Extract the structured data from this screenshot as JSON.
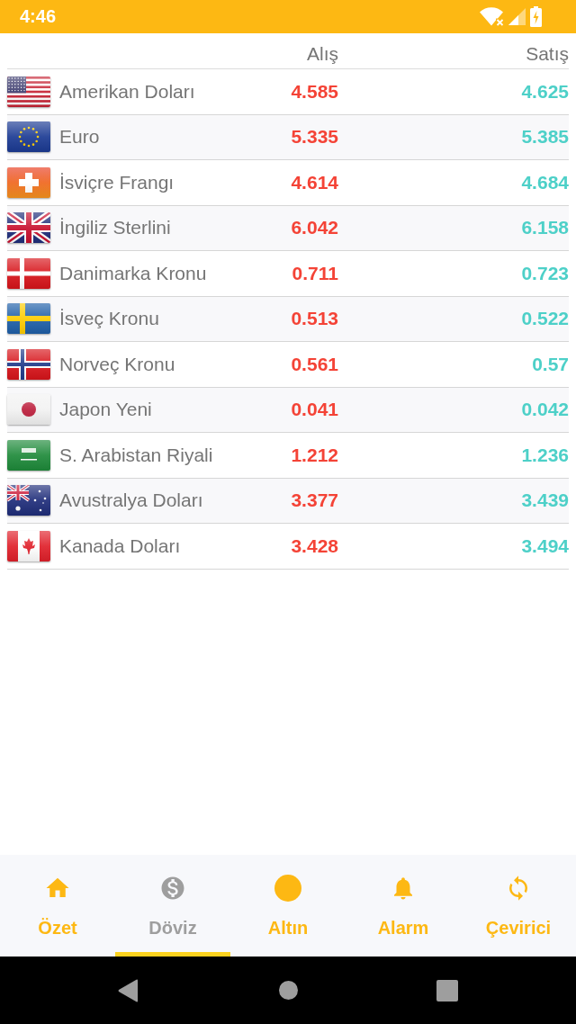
{
  "status_bar": {
    "time": "4:46"
  },
  "table": {
    "columns": [
      "Alış",
      "Satış"
    ],
    "rows": [
      {
        "kind": "us",
        "name": "Amerikan Doları",
        "buy": "4.585",
        "sell": "4.625"
      },
      {
        "kind": "eu",
        "name": "Euro",
        "buy": "5.335",
        "sell": "5.385"
      },
      {
        "kind": "ch",
        "name": "İsviçre Frangı",
        "buy": "4.614",
        "sell": "4.684"
      },
      {
        "kind": "gb",
        "name": "İngiliz Sterlini",
        "buy": "6.042",
        "sell": "6.158"
      },
      {
        "kind": "dk",
        "name": "Danimarka Kronu",
        "buy": "0.711",
        "sell": "0.723"
      },
      {
        "kind": "se",
        "name": "İsveç Kronu",
        "buy": "0.513",
        "sell": "0.522"
      },
      {
        "kind": "no",
        "name": "Norveç Kronu",
        "buy": "0.561",
        "sell": "0.57"
      },
      {
        "kind": "jp",
        "name": "Japon Yeni",
        "buy": "0.041",
        "sell": "0.042"
      },
      {
        "kind": "sa",
        "name": "S. Arabistan Riyali",
        "buy": "1.212",
        "sell": "1.236"
      },
      {
        "kind": "au",
        "name": "Avustralya Doları",
        "buy": "3.377",
        "sell": "3.439"
      },
      {
        "kind": "ca",
        "name": "Kanada Doları",
        "buy": "3.428",
        "sell": "3.494"
      }
    ]
  },
  "tabs": [
    {
      "kind": "home",
      "label": "Özet",
      "selected": false
    },
    {
      "kind": "dollar",
      "label": "Döviz",
      "selected": true
    },
    {
      "kind": "circle",
      "label": "Altın",
      "selected": false
    },
    {
      "kind": "bell",
      "label": "Alarm",
      "selected": false
    },
    {
      "kind": "sync",
      "label": "Çevirici",
      "selected": false
    }
  ]
}
